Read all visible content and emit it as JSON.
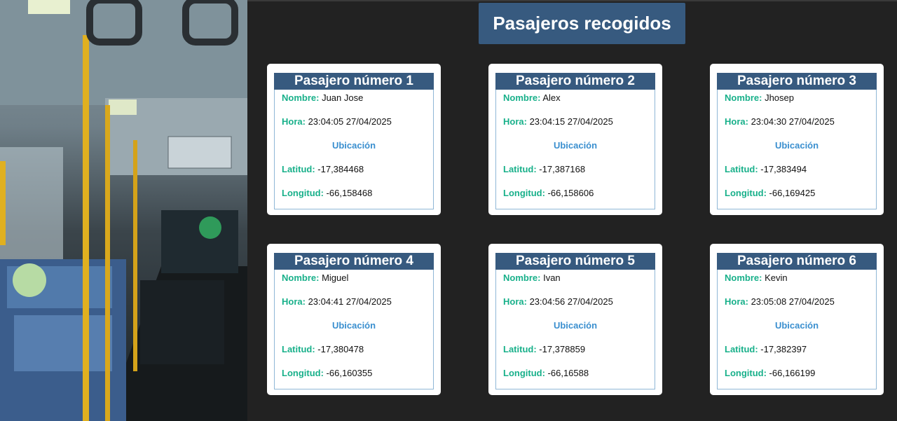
{
  "title": "Pasajeros recogidos",
  "labels": {
    "nombre": "Nombre:",
    "hora": "Hora:",
    "ubicacion": "Ubicación",
    "latitud": "Latitud:",
    "longitud": "Longitud:"
  },
  "colors": {
    "background": "#222222",
    "header": "#375a7f",
    "label": "#18b08a",
    "section": "#3a8fcf"
  },
  "passengers": [
    {
      "title": "Pasajero número 1",
      "nombre": "Juan Jose",
      "hora": "23:04:05 27/04/2025",
      "latitud": "-17,384468",
      "longitud": "-66,158468"
    },
    {
      "title": "Pasajero número 2",
      "nombre": "Alex",
      "hora": "23:04:15 27/04/2025",
      "latitud": "-17,387168",
      "longitud": "-66,158606"
    },
    {
      "title": "Pasajero número 3",
      "nombre": "Jhosep",
      "hora": "23:04:30 27/04/2025",
      "latitud": "-17,383494",
      "longitud": "-66,169425"
    },
    {
      "title": "Pasajero número 4",
      "nombre": "Miguel",
      "hora": "23:04:41 27/04/2025",
      "latitud": "-17,380478",
      "longitud": "-66,160355"
    },
    {
      "title": "Pasajero número 5",
      "nombre": "Ivan",
      "hora": "23:04:56 27/04/2025",
      "latitud": "-17,378859",
      "longitud": "-66,16588"
    },
    {
      "title": "Pasajero número 6",
      "nombre": "Kevin",
      "hora": "23:05:08 27/04/2025",
      "latitud": "-17,382397",
      "longitud": "-66,166199"
    }
  ]
}
